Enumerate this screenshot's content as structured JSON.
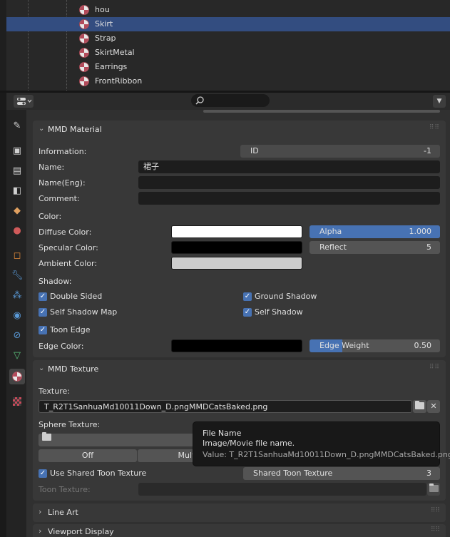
{
  "outliner": {
    "items": [
      {
        "label": "hou"
      },
      {
        "label": "Skirt"
      },
      {
        "label": "Strap"
      },
      {
        "label": "SkirtMetal"
      },
      {
        "label": "Earrings"
      },
      {
        "label": "FrontRibbon"
      }
    ],
    "selected": "Skirt"
  },
  "mmd_material": {
    "title": "MMD Material",
    "information_label": "Information:",
    "id_label": "ID",
    "id_value": "-1",
    "name_label": "Name:",
    "name_value": "裙子",
    "name_eng_label": "Name(Eng):",
    "name_eng_value": "",
    "comment_label": "Comment:",
    "comment_value": "",
    "color_label": "Color:",
    "diffuse_label": "Diffuse Color:",
    "diffuse_color": "#ffffff",
    "alpha_label": "Alpha",
    "alpha_value": "1.000",
    "alpha_fraction": 1.0,
    "specular_label": "Specular Color:",
    "specular_color": "#000000",
    "reflect_label": "Reflect",
    "reflect_value": "5",
    "ambient_label": "Ambient Color:",
    "ambient_color": "#cccccc",
    "shadow_label": "Shadow:",
    "double_sided": "Double Sided",
    "ground_shadow": "Ground Shadow",
    "self_shadow_map": "Self Shadow Map",
    "self_shadow": "Self Shadow",
    "toon_edge": "Toon Edge",
    "edge_color_label": "Edge Color:",
    "edge_color": "#000000",
    "edge_weight_label": "Edge Weight",
    "edge_weight_value": "0.50",
    "edge_weight_fraction": 0.25
  },
  "mmd_texture": {
    "title": "MMD Texture",
    "texture_label": "Texture:",
    "texture_value": "T_R2T1SanhuaMd10011Down_D.pngMMDCatsBaked.png",
    "sphere_label": "Sphere Texture:",
    "off_label": "Off",
    "multi_label": "Multi",
    "use_shared_toon": "Use Shared Toon Texture",
    "shared_toon_label": "Shared Toon Texture",
    "shared_toon_value": "3",
    "toon_texture_label": "Toon Texture:"
  },
  "tooltip": {
    "title": "File Name",
    "description": "Image/Movie file name.",
    "value": "Value: T_R2T1SanhuaMd10011Down_D.pngMMDCatsBaked.png"
  },
  "panels": {
    "line_art": "Line Art",
    "viewport_display": "Viewport Display"
  },
  "colors": {
    "accent": "#4772b3",
    "selection": "#334d80"
  }
}
